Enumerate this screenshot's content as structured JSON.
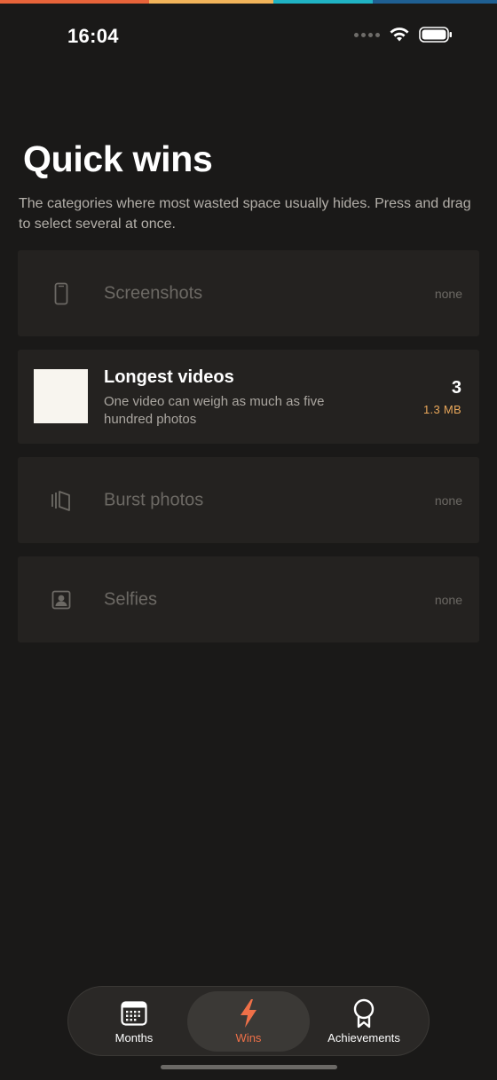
{
  "colors": {
    "background": "#1a1918",
    "card": "#242220",
    "accent_orange": "#ef7048",
    "size_amber": "#e9a75a",
    "strip": [
      "#e8643a",
      "#f2b45a",
      "#20b3c4",
      "#1f5f92"
    ]
  },
  "status_bar": {
    "time": "16:04",
    "icons": [
      "signal-icon",
      "wifi-icon",
      "battery-icon"
    ]
  },
  "header": {
    "title": "Quick wins",
    "subtitle": "The categories where most wasted space usually hides. Press and drag to select several at once."
  },
  "categories": [
    {
      "name": "Screenshots",
      "icon": "phone-icon",
      "count": "none"
    },
    {
      "name": "Longest videos",
      "description": "One video can weigh as much as five hundred photos",
      "count": "3",
      "size": "1.3 MB"
    },
    {
      "name": "Burst photos",
      "icon": "burst-stack-icon",
      "count": "none"
    },
    {
      "name": "Selfies",
      "icon": "portrait-icon",
      "count": "none"
    }
  ],
  "tab_bar": {
    "tabs": [
      {
        "label": "Months",
        "icon": "calendar-icon"
      },
      {
        "label": "Wins",
        "icon": "bolt-icon",
        "selected": true
      },
      {
        "label": "Achievements",
        "icon": "ribbon-badge-icon"
      }
    ]
  }
}
